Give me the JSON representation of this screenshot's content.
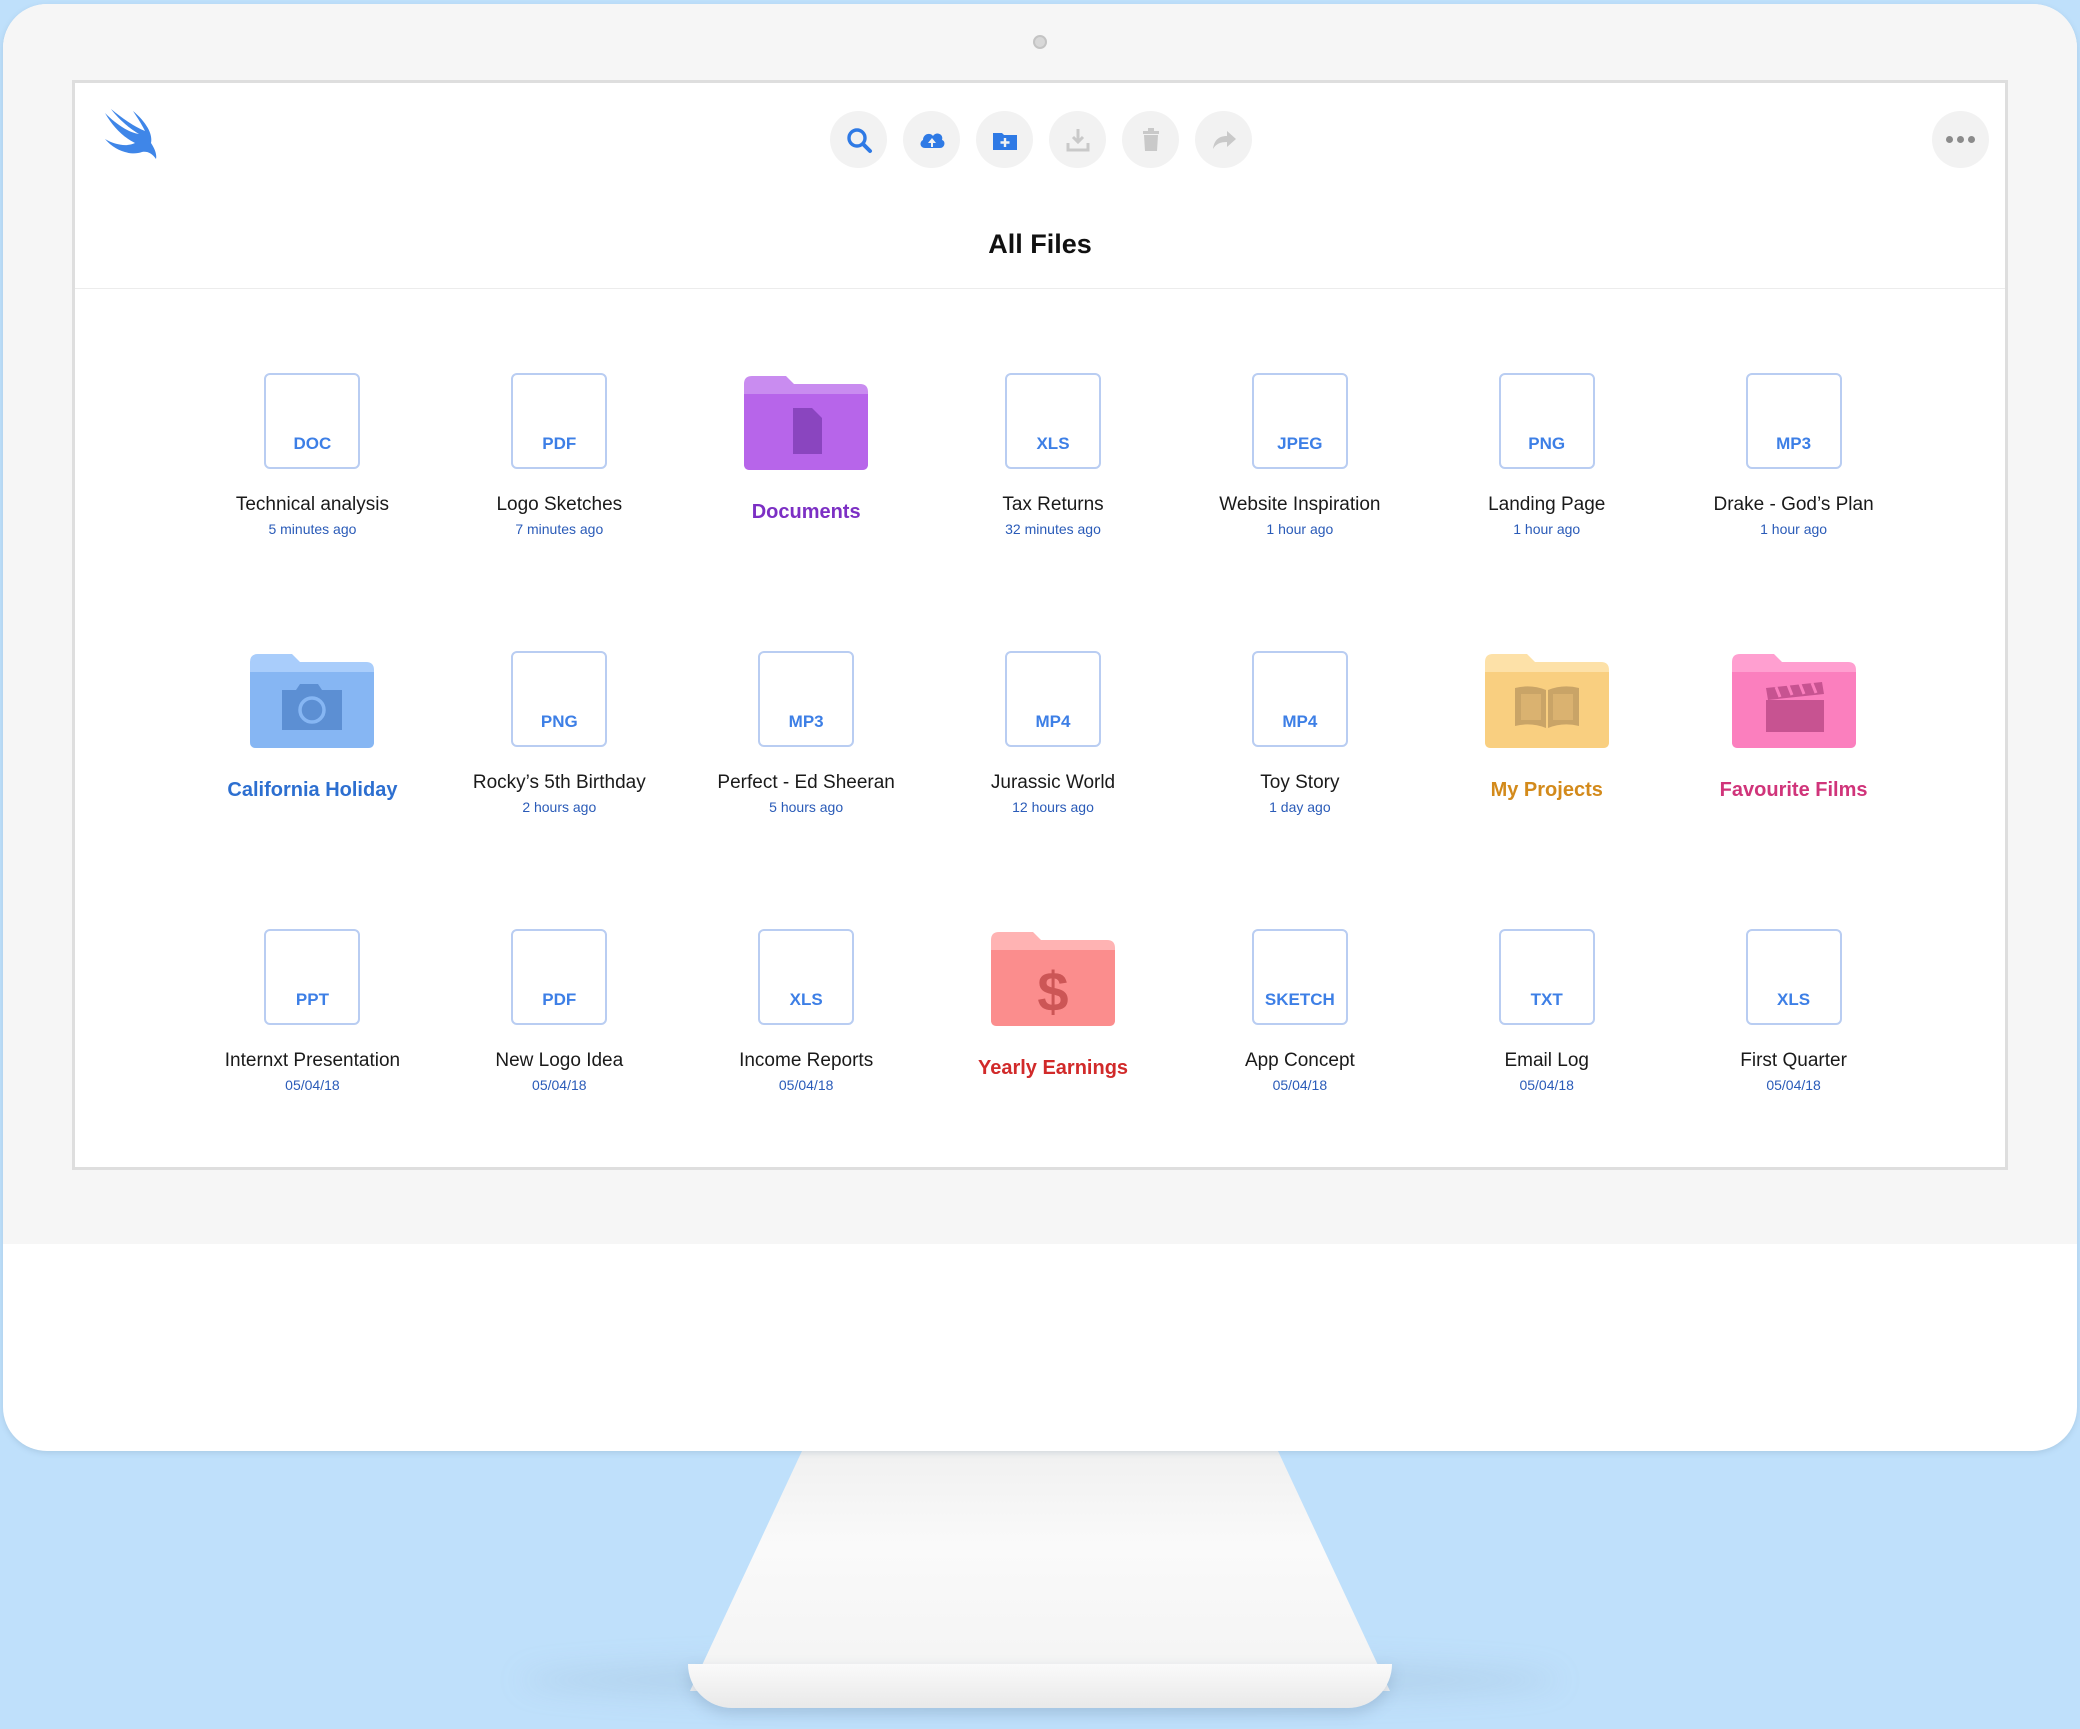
{
  "title": "All Files",
  "toolbar": {
    "buttons": [
      {
        "icon": "search-icon"
      },
      {
        "icon": "cloud-upload-icon"
      },
      {
        "icon": "new-folder-icon"
      },
      {
        "icon": "download-icon"
      },
      {
        "icon": "trash-icon"
      },
      {
        "icon": "share-icon"
      }
    ],
    "more_icon": "more-icon"
  },
  "colors": {
    "accent": "#3d7fe6",
    "documents": "#7c2fc4",
    "california": "#2d6fd0",
    "projects": "#d38a1b",
    "films": "#d0347a",
    "earnings": "#d12a2a"
  },
  "items": [
    {
      "kind": "file",
      "ext": "DOC",
      "name": "Technical analysis",
      "time": "5 minutes ago"
    },
    {
      "kind": "file",
      "ext": "PDF",
      "name": "Logo Sketches",
      "time": "7 minutes ago"
    },
    {
      "kind": "folder",
      "name": "Documents",
      "style": "documents"
    },
    {
      "kind": "file",
      "ext": "XLS",
      "name": "Tax Returns",
      "time": "32 minutes ago"
    },
    {
      "kind": "file",
      "ext": "JPEG",
      "name": "Website Inspiration",
      "time": "1 hour ago"
    },
    {
      "kind": "file",
      "ext": "PNG",
      "name": "Landing Page",
      "time": "1 hour ago"
    },
    {
      "kind": "file",
      "ext": "MP3",
      "name": "Drake - God’s Plan",
      "time": "1 hour ago"
    },
    {
      "kind": "folder",
      "name": "California Holiday",
      "style": "california"
    },
    {
      "kind": "file",
      "ext": "PNG",
      "name": "Rocky’s 5th Birthday",
      "time": "2 hours ago"
    },
    {
      "kind": "file",
      "ext": "MP3",
      "name": "Perfect - Ed Sheeran",
      "time": "5 hours ago"
    },
    {
      "kind": "file",
      "ext": "MP4",
      "name": "Jurassic World",
      "time": "12 hours ago"
    },
    {
      "kind": "file",
      "ext": "MP4",
      "name": "Toy Story",
      "time": "1 day ago"
    },
    {
      "kind": "folder",
      "name": "My Projects",
      "style": "projects"
    },
    {
      "kind": "folder",
      "name": "Favourite Films",
      "style": "films"
    },
    {
      "kind": "file",
      "ext": "PPT",
      "name": "Internxt Presentation",
      "time": "05/04/18"
    },
    {
      "kind": "file",
      "ext": "PDF",
      "name": "New Logo Idea",
      "time": "05/04/18"
    },
    {
      "kind": "file",
      "ext": "XLS",
      "name": "Income Reports",
      "time": "05/04/18"
    },
    {
      "kind": "folder",
      "name": "Yearly Earnings",
      "style": "earnings"
    },
    {
      "kind": "file",
      "ext": "SKETCH",
      "name": "App Concept",
      "time": "05/04/18"
    },
    {
      "kind": "file",
      "ext": "TXT",
      "name": "Email Log",
      "time": "05/04/18"
    },
    {
      "kind": "file",
      "ext": "XLS",
      "name": "First Quarter",
      "time": "05/04/18"
    }
  ]
}
